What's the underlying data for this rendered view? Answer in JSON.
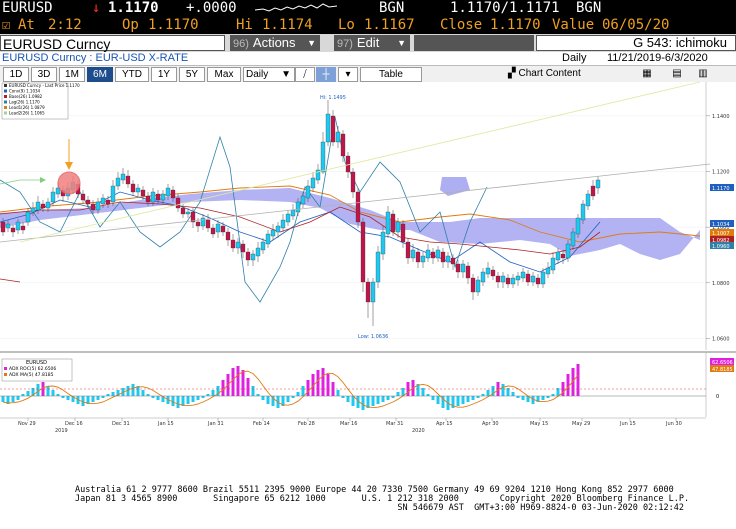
{
  "header": {
    "ticker": "EURUSD",
    "last_arrow": "↓",
    "last_price": "1.1170",
    "change": "+.0000",
    "source_label": "BGN",
    "bid_ask": "1.1170/1.1171",
    "source_label_2": "BGN",
    "at_label": "At",
    "at_time": "2:12",
    "open_label": "Op",
    "open_value": "1.1170",
    "high_label": "Hi",
    "high_value": "1.1174",
    "low_label": "Lo",
    "low_value": "1.1167",
    "close_label": "Close",
    "close_value": "1.1170",
    "value_label": "Value",
    "value_date": "06/05/20"
  },
  "menubar": {
    "security_title": "EURUSD Curncy",
    "actions_num": "96)",
    "actions_label": "Actions",
    "edit_num": "97)",
    "edit_label": "Edit",
    "page_title": "G 543: ichimoku"
  },
  "subtitle": {
    "description": "EURUSD Curncy : EUR-USD X-RATE",
    "period": "Daily",
    "range": "11/21/2019-6/3/2020"
  },
  "toolbar": {
    "ranges": [
      "1D",
      "3D",
      "1M",
      "6M",
      "YTD",
      "1Y",
      "5Y",
      "Max"
    ],
    "active_range": "6M",
    "period_select": "Daily",
    "table_label": "Table",
    "chart_content_label": "Chart Content"
  },
  "legend": {
    "items": [
      {
        "label": "EURUSD Curncy - Last Price 1.1170",
        "color": "#333333"
      },
      {
        "label": "Conv(9)        1.1034",
        "color": "#1f5fbf"
      },
      {
        "label": "Base(26)       1.0982",
        "color": "#b02020"
      },
      {
        "label": "Lag(26)        1.1170",
        "color": "#2f7fa8"
      },
      {
        "label": "Lead1(26)      1.0879",
        "color": "#e07b10"
      },
      {
        "label": "Lead2(26)      1.1065",
        "color": "#9fd39f"
      }
    ]
  },
  "price_axis": {
    "ticks": [
      "1.1400",
      "1.1200",
      "1.1000",
      "1.0800",
      "1.0600"
    ],
    "tags": [
      {
        "text": "1.1170",
        "color": "#1f5fbf"
      },
      {
        "text": "1.1034",
        "color": "#1f5fbf"
      },
      {
        "text": "1.1007",
        "color": "#e07b10"
      },
      {
        "text": "1.0982",
        "color": "#b02020"
      },
      {
        "text": "1.0960",
        "color": "#2f7fa8"
      }
    ]
  },
  "annotations": {
    "high": "Hi: 1.1495",
    "low": "Low: 1.0636"
  },
  "lower_panel": {
    "title": "EURUSD",
    "legend": [
      {
        "label": "ADX ROC(5)  62.6506",
        "color": "#e020e0"
      },
      {
        "label": "ADX MA(5)   47.8185",
        "color": "#e07b10"
      }
    ],
    "tags": [
      {
        "text": "62.6506",
        "color": "#e020e0"
      },
      {
        "text": "47.8185",
        "color": "#e07b10"
      }
    ],
    "zero": "0"
  },
  "x_axis": {
    "labels": [
      "Nov 29",
      "Dec 16",
      "Dec 31",
      "Jan 15",
      "Jan 31",
      "Feb 14",
      "Feb 28",
      "Mar 16",
      "Mar 31",
      "Apr 15",
      "Apr 30",
      "May 15",
      "May 29",
      "Jun 15",
      "Jun 30"
    ],
    "years": [
      "2019",
      "2020"
    ]
  },
  "footer": {
    "line1": "Australia 61 2 9777 8600 Brazil 5511 2395 9000 Europe 44 20 7330 7500 Germany 49 69 9204 1210 Hong Kong 852 2977 6000",
    "line2": "Japan 81 3 4565 8900       Singapore 65 6212 1000       U.S. 1 212 318 2000        Copyright 2020 Bloomberg Finance L.P.",
    "line3": "                                                               SN 546679 AST  GMT+3:00 H969-8824-0 03-Jun-2020 02:12:42"
  },
  "colors": {
    "bull": "#1ec8f0",
    "bear": "#c0154a",
    "cloud": "#9a9af0",
    "orange": "#f0a020",
    "magenta": "#e020e0",
    "cyan": "#1ec8f0"
  }
}
